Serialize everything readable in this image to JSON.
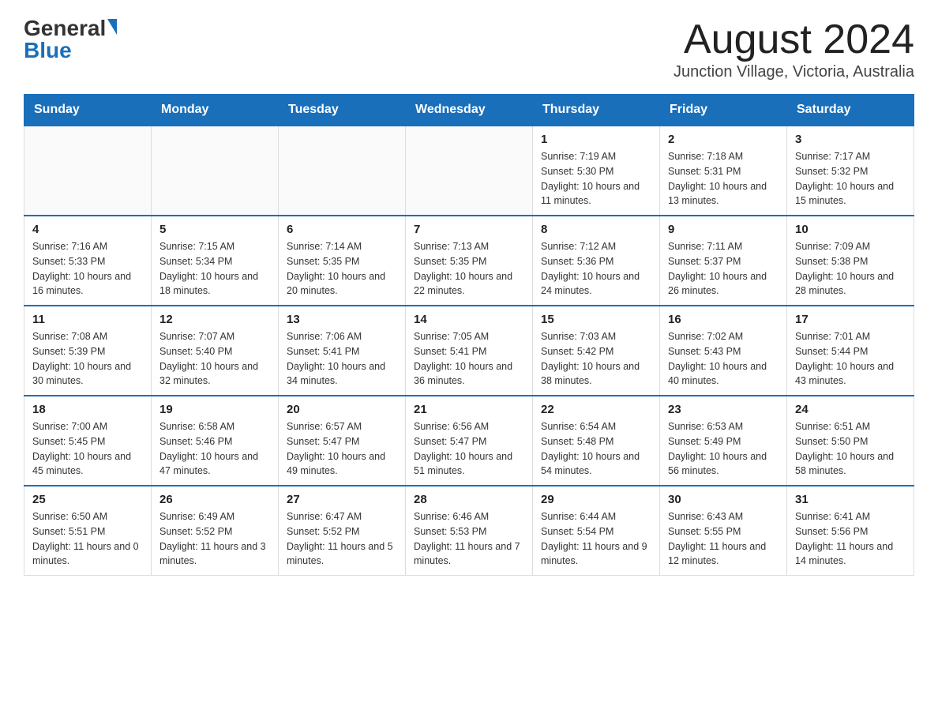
{
  "header": {
    "logo_general": "General",
    "logo_blue": "Blue",
    "month_title": "August 2024",
    "location": "Junction Village, Victoria, Australia"
  },
  "days_of_week": [
    "Sunday",
    "Monday",
    "Tuesday",
    "Wednesday",
    "Thursday",
    "Friday",
    "Saturday"
  ],
  "weeks": [
    {
      "days": [
        {
          "number": "",
          "info": ""
        },
        {
          "number": "",
          "info": ""
        },
        {
          "number": "",
          "info": ""
        },
        {
          "number": "",
          "info": ""
        },
        {
          "number": "1",
          "info": "Sunrise: 7:19 AM\nSunset: 5:30 PM\nDaylight: 10 hours and 11 minutes."
        },
        {
          "number": "2",
          "info": "Sunrise: 7:18 AM\nSunset: 5:31 PM\nDaylight: 10 hours and 13 minutes."
        },
        {
          "number": "3",
          "info": "Sunrise: 7:17 AM\nSunset: 5:32 PM\nDaylight: 10 hours and 15 minutes."
        }
      ]
    },
    {
      "days": [
        {
          "number": "4",
          "info": "Sunrise: 7:16 AM\nSunset: 5:33 PM\nDaylight: 10 hours and 16 minutes."
        },
        {
          "number": "5",
          "info": "Sunrise: 7:15 AM\nSunset: 5:34 PM\nDaylight: 10 hours and 18 minutes."
        },
        {
          "number": "6",
          "info": "Sunrise: 7:14 AM\nSunset: 5:35 PM\nDaylight: 10 hours and 20 minutes."
        },
        {
          "number": "7",
          "info": "Sunrise: 7:13 AM\nSunset: 5:35 PM\nDaylight: 10 hours and 22 minutes."
        },
        {
          "number": "8",
          "info": "Sunrise: 7:12 AM\nSunset: 5:36 PM\nDaylight: 10 hours and 24 minutes."
        },
        {
          "number": "9",
          "info": "Sunrise: 7:11 AM\nSunset: 5:37 PM\nDaylight: 10 hours and 26 minutes."
        },
        {
          "number": "10",
          "info": "Sunrise: 7:09 AM\nSunset: 5:38 PM\nDaylight: 10 hours and 28 minutes."
        }
      ]
    },
    {
      "days": [
        {
          "number": "11",
          "info": "Sunrise: 7:08 AM\nSunset: 5:39 PM\nDaylight: 10 hours and 30 minutes."
        },
        {
          "number": "12",
          "info": "Sunrise: 7:07 AM\nSunset: 5:40 PM\nDaylight: 10 hours and 32 minutes."
        },
        {
          "number": "13",
          "info": "Sunrise: 7:06 AM\nSunset: 5:41 PM\nDaylight: 10 hours and 34 minutes."
        },
        {
          "number": "14",
          "info": "Sunrise: 7:05 AM\nSunset: 5:41 PM\nDaylight: 10 hours and 36 minutes."
        },
        {
          "number": "15",
          "info": "Sunrise: 7:03 AM\nSunset: 5:42 PM\nDaylight: 10 hours and 38 minutes."
        },
        {
          "number": "16",
          "info": "Sunrise: 7:02 AM\nSunset: 5:43 PM\nDaylight: 10 hours and 40 minutes."
        },
        {
          "number": "17",
          "info": "Sunrise: 7:01 AM\nSunset: 5:44 PM\nDaylight: 10 hours and 43 minutes."
        }
      ]
    },
    {
      "days": [
        {
          "number": "18",
          "info": "Sunrise: 7:00 AM\nSunset: 5:45 PM\nDaylight: 10 hours and 45 minutes."
        },
        {
          "number": "19",
          "info": "Sunrise: 6:58 AM\nSunset: 5:46 PM\nDaylight: 10 hours and 47 minutes."
        },
        {
          "number": "20",
          "info": "Sunrise: 6:57 AM\nSunset: 5:47 PM\nDaylight: 10 hours and 49 minutes."
        },
        {
          "number": "21",
          "info": "Sunrise: 6:56 AM\nSunset: 5:47 PM\nDaylight: 10 hours and 51 minutes."
        },
        {
          "number": "22",
          "info": "Sunrise: 6:54 AM\nSunset: 5:48 PM\nDaylight: 10 hours and 54 minutes."
        },
        {
          "number": "23",
          "info": "Sunrise: 6:53 AM\nSunset: 5:49 PM\nDaylight: 10 hours and 56 minutes."
        },
        {
          "number": "24",
          "info": "Sunrise: 6:51 AM\nSunset: 5:50 PM\nDaylight: 10 hours and 58 minutes."
        }
      ]
    },
    {
      "days": [
        {
          "number": "25",
          "info": "Sunrise: 6:50 AM\nSunset: 5:51 PM\nDaylight: 11 hours and 0 minutes."
        },
        {
          "number": "26",
          "info": "Sunrise: 6:49 AM\nSunset: 5:52 PM\nDaylight: 11 hours and 3 minutes."
        },
        {
          "number": "27",
          "info": "Sunrise: 6:47 AM\nSunset: 5:52 PM\nDaylight: 11 hours and 5 minutes."
        },
        {
          "number": "28",
          "info": "Sunrise: 6:46 AM\nSunset: 5:53 PM\nDaylight: 11 hours and 7 minutes."
        },
        {
          "number": "29",
          "info": "Sunrise: 6:44 AM\nSunset: 5:54 PM\nDaylight: 11 hours and 9 minutes."
        },
        {
          "number": "30",
          "info": "Sunrise: 6:43 AM\nSunset: 5:55 PM\nDaylight: 11 hours and 12 minutes."
        },
        {
          "number": "31",
          "info": "Sunrise: 6:41 AM\nSunset: 5:56 PM\nDaylight: 11 hours and 14 minutes."
        }
      ]
    }
  ]
}
